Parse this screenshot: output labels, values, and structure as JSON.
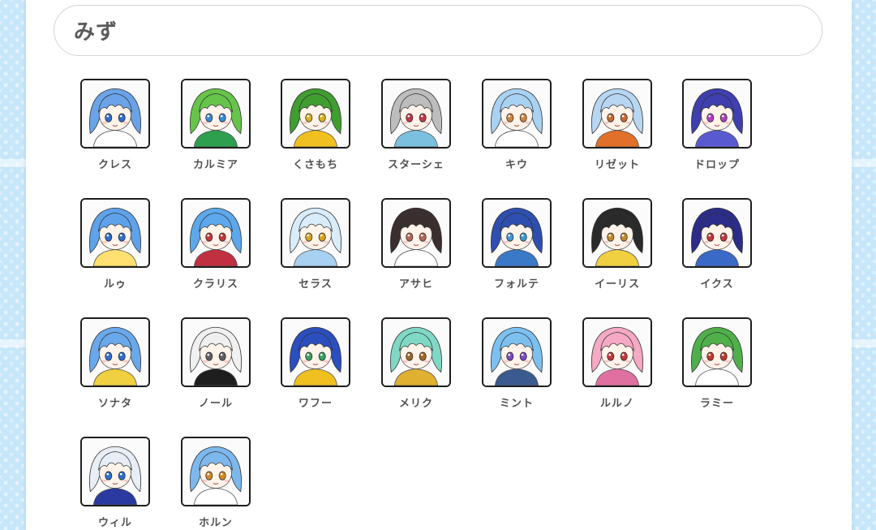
{
  "search": {
    "value": "みず"
  },
  "characters": [
    {
      "name": "クレス",
      "hair": "#6aa3e8",
      "eyes": "#2f6fd0",
      "accent": "#ffffff"
    },
    {
      "name": "カルミア",
      "hair": "#67c44a",
      "eyes": "#3a8ad6",
      "accent": "#2e9e4f"
    },
    {
      "name": "くさもち",
      "hair": "#3f9e2f",
      "eyes": "#d8b020",
      "accent": "#f0c020"
    },
    {
      "name": "スターシェ",
      "hair": "#bdbdbd",
      "eyes": "#c0394b",
      "accent": "#7cc0e0"
    },
    {
      "name": "キウ",
      "hair": "#a9d2f2",
      "eyes": "#d0863a",
      "accent": "#ffffff"
    },
    {
      "name": "リゼット",
      "hair": "#b7d6f2",
      "eyes": "#c46a30",
      "accent": "#e0702a"
    },
    {
      "name": "ドロップ",
      "hair": "#3f3fb0",
      "eyes": "#b040c0",
      "accent": "#5a5ad0"
    },
    {
      "name": "ルゥ",
      "hair": "#5ea2ea",
      "eyes": "#2f6fd0",
      "accent": "#ffe070"
    },
    {
      "name": "クラリス",
      "hair": "#5da8ec",
      "eyes": "#c0393b",
      "accent": "#c03040"
    },
    {
      "name": "セラス",
      "hair": "#d9ecfa",
      "eyes": "#d8a020",
      "accent": "#a8d0f0"
    },
    {
      "name": "アサヒ",
      "hair": "#3a2e2e",
      "eyes": "#b06a5a",
      "accent": "#ffffff"
    },
    {
      "name": "フォルテ",
      "hair": "#2e4fb0",
      "eyes": "#3a9ad6",
      "accent": "#3a78c8"
    },
    {
      "name": "イーリス",
      "hair": "#2a2a2a",
      "eyes": "#c08a30",
      "accent": "#f0d040"
    },
    {
      "name": "イクス",
      "hair": "#2c2c8a",
      "eyes": "#c0393b",
      "accent": "#3a6ac8"
    },
    {
      "name": "ソナタ",
      "hair": "#6aa8ec",
      "eyes": "#2f6fd0",
      "accent": "#f0d040"
    },
    {
      "name": "ノール",
      "hair": "#f0f0f0",
      "eyes": "#606060",
      "accent": "#1e1e1e"
    },
    {
      "name": "ワフー",
      "hair": "#2b4fbf",
      "eyes": "#3aa060",
      "accent": "#f0c020"
    },
    {
      "name": "メリク",
      "hair": "#7fd8c4",
      "eyes": "#a0682a",
      "accent": "#e0b030"
    },
    {
      "name": "ミント",
      "hair": "#7cc0f0",
      "eyes": "#7a4ac0",
      "accent": "#3a5a90"
    },
    {
      "name": "ルルノ",
      "hair": "#f5a9c4",
      "eyes": "#c0393b",
      "accent": "#e070a0"
    },
    {
      "name": "ラミー",
      "hair": "#4fb04a",
      "eyes": "#c0392b",
      "accent": "#ffffff"
    },
    {
      "name": "ウィル",
      "hair": "#e8eef6",
      "eyes": "#2f6fd0",
      "accent": "#2a3aa0"
    },
    {
      "name": "ホルン",
      "hair": "#7cb8ec",
      "eyes": "#d08a2a",
      "accent": "#ffffff"
    }
  ]
}
